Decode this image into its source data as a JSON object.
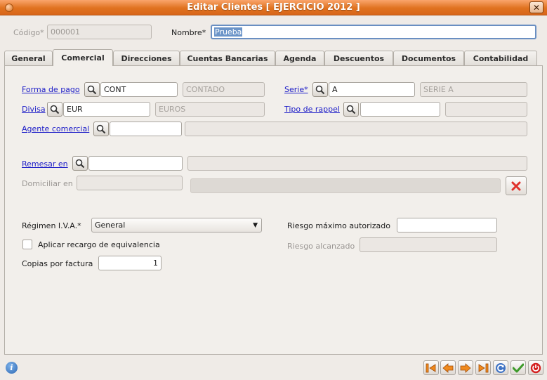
{
  "window": {
    "title": "Editar Clientes [ EJERCICIO 2012 ]",
    "close_glyph": "✕"
  },
  "header": {
    "codigo_label": "Código*",
    "codigo_value": "000001",
    "nombre_label": "Nombre*",
    "nombre_value": "Prueba"
  },
  "tabs": [
    {
      "label": "General"
    },
    {
      "label": "Comercial"
    },
    {
      "label": "Direcciones"
    },
    {
      "label": "Cuentas Bancarias"
    },
    {
      "label": "Agenda"
    },
    {
      "label": "Descuentos"
    },
    {
      "label": "Documentos"
    },
    {
      "label": "Contabilidad"
    }
  ],
  "active_tab": "Comercial",
  "comercial": {
    "forma_pago": {
      "label": "Forma de pago",
      "code": "CONT",
      "desc": "CONTADO"
    },
    "serie": {
      "label": "Serie*",
      "code": "A",
      "desc": "SERIE A"
    },
    "divisa": {
      "label": "Divisa",
      "code": "EUR",
      "desc": "EUROS"
    },
    "tipo_rappel": {
      "label": "Tipo de rappel",
      "code": "",
      "desc": ""
    },
    "agente": {
      "label": "Agente comercial",
      "code": "",
      "desc": ""
    },
    "remesar": {
      "label": "Remesar en",
      "code": "",
      "desc": ""
    },
    "domiciliar": {
      "label": "Domiciliar en",
      "value": "",
      "desc": ""
    },
    "regimen_iva": {
      "label": "Régimen I.V.A.*",
      "selected": "General"
    },
    "recargo": {
      "label": "Aplicar recargo de equivalencia",
      "checked": false
    },
    "copias": {
      "label": "Copias por factura",
      "value": "1"
    },
    "riesgo_max": {
      "label": "Riesgo máximo autorizado",
      "value": ""
    },
    "riesgo_alc": {
      "label": "Riesgo alcanzado",
      "value": ""
    }
  },
  "footer": {
    "info_glyph": "i",
    "buttons": [
      "first-record",
      "previous-record",
      "next-record",
      "last-record",
      "refresh",
      "accept",
      "exit"
    ]
  },
  "colors": {
    "titlebar": "#e0721f",
    "link": "#2020c8",
    "nav_orange": "#f08a1e",
    "accept_green": "#3d9a2a",
    "exit_red": "#d42020"
  }
}
